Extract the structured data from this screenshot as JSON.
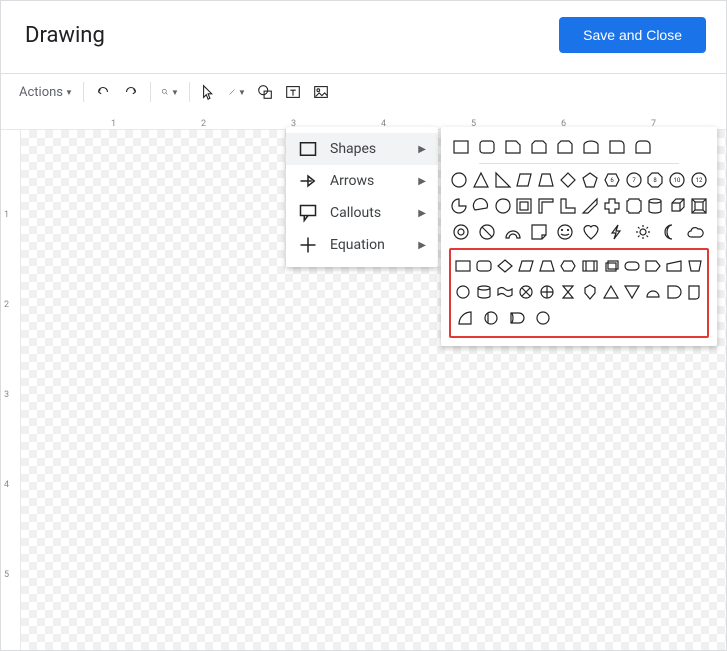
{
  "header": {
    "title": "Drawing",
    "save_label": "Save and Close"
  },
  "toolbar": {
    "actions_label": "Actions",
    "items": [
      "undo",
      "redo",
      "zoom",
      "select",
      "line",
      "shapes",
      "textbox",
      "image"
    ]
  },
  "menu": {
    "items": [
      {
        "icon": "rect",
        "label": "Shapes",
        "hover": true
      },
      {
        "icon": "arrow",
        "label": "Arrows",
        "hover": false
      },
      {
        "icon": "callout",
        "label": "Callouts",
        "hover": false
      },
      {
        "icon": "plus",
        "label": "Equation",
        "hover": false
      }
    ]
  },
  "ruler": {
    "h": [
      "1",
      "2",
      "3",
      "4",
      "5",
      "6",
      "7"
    ],
    "v": [
      "1",
      "2",
      "3",
      "4",
      "5"
    ]
  },
  "chart_data": {
    "type": "table",
    "note": "shape picker grid; no numeric data"
  },
  "shapes": {
    "group1": [
      [
        "rect",
        "roundrect",
        "snip1",
        "snip2",
        "snip3",
        "roundtop",
        "round1",
        "round2"
      ]
    ],
    "group2": [
      [
        "circle",
        "triangle",
        "rtriangle",
        "parallelogram",
        "trapezoid",
        "diamond",
        "pentagon",
        "hexagon",
        "heptagon",
        "octagon",
        "decagon",
        "dodecagon"
      ],
      [
        "pie",
        "chord",
        "teardrop",
        "frame",
        "halfframe",
        "lshape",
        "diagstripe",
        "cross",
        "plaque",
        "can",
        "cube",
        "bevel"
      ],
      [
        "donut",
        "noentry",
        "blockarc",
        "foldedcorner",
        "smiley",
        "heart",
        "lightning",
        "sun",
        "moon",
        "cloud"
      ]
    ],
    "group3_highlighted": [
      [
        "fc-rect",
        "fc-roundrect",
        "fc-diamond",
        "fc-parallelogram",
        "fc-trapezoid",
        "fc-hexagon",
        "fc-stripe",
        "fc-stack",
        "fc-pill",
        "fc-pentagon",
        "fc-manualinput",
        "fc-bucket"
      ],
      [
        "fc-circle",
        "fc-drum",
        "fc-wave",
        "fc-xcircle",
        "fc-pluscircle",
        "fc-hourglass",
        "fc-shield",
        "fc-triangle",
        "fc-triangledown",
        "fc-halfcircle",
        "fc-dshape",
        "fc-qshape"
      ],
      [
        "fc-qcircle",
        "fc-dcircle2",
        "fc-dshape2",
        "fc-circle2"
      ]
    ]
  }
}
